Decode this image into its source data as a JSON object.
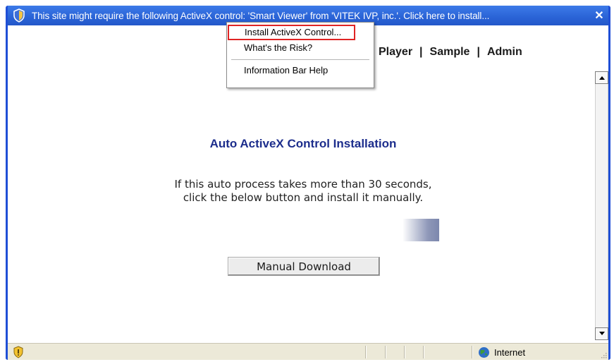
{
  "infobar": {
    "message": "This site might require the following ActiveX control: 'Smart Viewer' from 'VITEK IVP, inc.'. Click here to install...",
    "icon": "shield-icon",
    "close_icon": "close-icon"
  },
  "context_menu": {
    "items": [
      {
        "label": "Install ActiveX Control..."
      },
      {
        "label": "What's the Risk?"
      },
      {
        "label": "Information Bar Help"
      }
    ]
  },
  "topnav": {
    "items": [
      "Player",
      "Sample",
      "Admin"
    ],
    "separator": "|"
  },
  "content": {
    "title": "Auto ActiveX Control Installation",
    "line1": "If this auto process takes more than 30 seconds,",
    "line2": "click the below button and install it manually.",
    "button_label": "Manual Download"
  },
  "statusbar": {
    "zone_label": "Internet",
    "warning_icon": "warning-shield-icon",
    "zone_icon": "globe-icon"
  },
  "colors": {
    "infobar_blue": "#2a63d6",
    "title_blue": "#1c2d8c",
    "highlight_red": "#e02424",
    "status_gray": "#ece9d8"
  }
}
